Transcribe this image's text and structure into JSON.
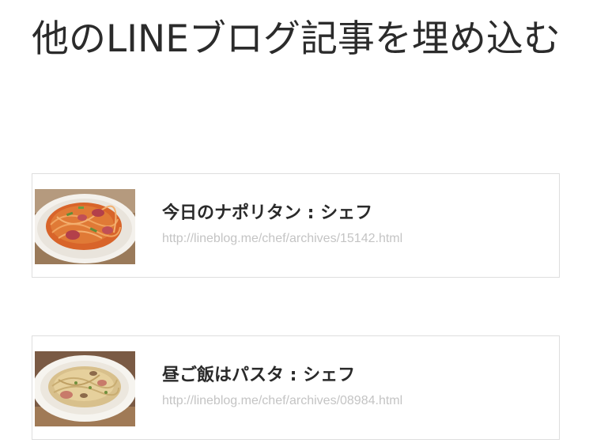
{
  "heading": "他のLINEブログ記事を埋め込む",
  "cards": [
    {
      "title": "今日のナポリタン : シェフ",
      "url": "http://lineblog.me/chef/archives/15142.html",
      "thumbnail": "napolitan-pasta-photo"
    },
    {
      "title": "昼ご飯はパスタ : シェフ",
      "url": "http://lineblog.me/chef/archives/08984.html",
      "thumbnail": "lunch-pasta-photo"
    }
  ],
  "colors": {
    "heading_text": "#2b2b2b",
    "card_border": "#dedede",
    "url_text": "#c4c4c4"
  }
}
